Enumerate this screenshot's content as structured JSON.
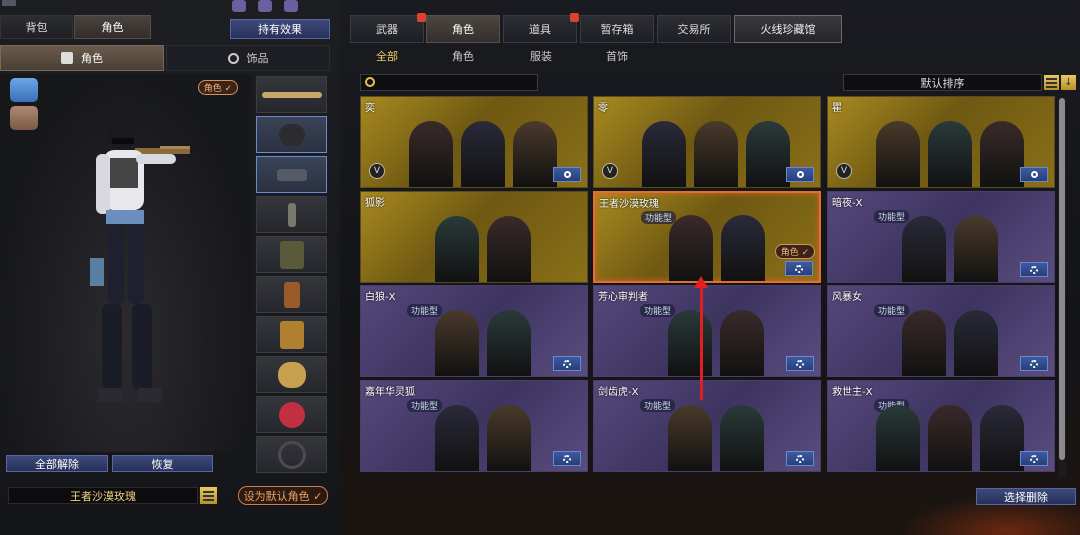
{
  "left_tabs": {
    "bag": "背包",
    "character": "角色",
    "effects": "持有效果"
  },
  "sub_tabs": {
    "character": "角色",
    "accessories": "饰品"
  },
  "role_badge": "角色 ✓",
  "actions": {
    "unequip_all": "全部解除",
    "restore": "恢复",
    "set_default": "设为默认角色 ✓"
  },
  "selected_name": "王者沙漠玫瑰",
  "main_tabs": [
    "武器",
    "角色",
    "道具",
    "暂存箱",
    "交易所",
    "火线珍藏馆"
  ],
  "filter_tabs": [
    "全部",
    "角色",
    "服装",
    "首饰"
  ],
  "sort_label": "默认排序",
  "cards": [
    {
      "name": "奕",
      "tag": "",
      "style": "gold",
      "icon": "magnify",
      "portraits": 3,
      "v": true
    },
    {
      "name": "零",
      "tag": "",
      "style": "gold",
      "icon": "magnify",
      "portraits": 3,
      "v": true
    },
    {
      "name": "瞿",
      "tag": "",
      "style": "gold",
      "icon": "magnify",
      "portraits": 3,
      "v": true
    },
    {
      "name": "狐影",
      "tag": "",
      "style": "gold",
      "icon": "none",
      "portraits": 2,
      "v": false
    },
    {
      "name": "王者沙漠玫瑰",
      "tag": "功能型",
      "style": "gold",
      "icon": "gear",
      "portraits": 2,
      "v": false,
      "owned": "角色 ✓"
    },
    {
      "name": "暗夜-X",
      "tag": "功能型",
      "style": "purple",
      "icon": "gear",
      "portraits": 2,
      "v": false
    },
    {
      "name": "白狼-X",
      "tag": "功能型",
      "style": "purple",
      "icon": "gear",
      "portraits": 2,
      "v": false
    },
    {
      "name": "芳心审判者",
      "tag": "功能型",
      "style": "purple",
      "icon": "gear",
      "portraits": 2,
      "v": false
    },
    {
      "name": "风暴女",
      "tag": "功能型",
      "style": "purple",
      "icon": "gear",
      "portraits": 2,
      "v": false
    },
    {
      "name": "嘉年华灵狐",
      "tag": "功能型",
      "style": "purple",
      "icon": "gear",
      "portraits": 2,
      "v": false
    },
    {
      "name": "剑齿虎-X",
      "tag": "功能型",
      "style": "purple",
      "icon": "gear",
      "portraits": 2,
      "v": false
    },
    {
      "name": "救世主-X",
      "tag": "功能型",
      "style": "purple",
      "icon": "gear",
      "portraits": 3,
      "v": false
    }
  ],
  "delete_label": "选择删除",
  "colors": {
    "accent_gold": "#e8c050",
    "selection": "#e07030",
    "button_blue": "#3d4a7a",
    "arrow_red": "#e02020"
  }
}
